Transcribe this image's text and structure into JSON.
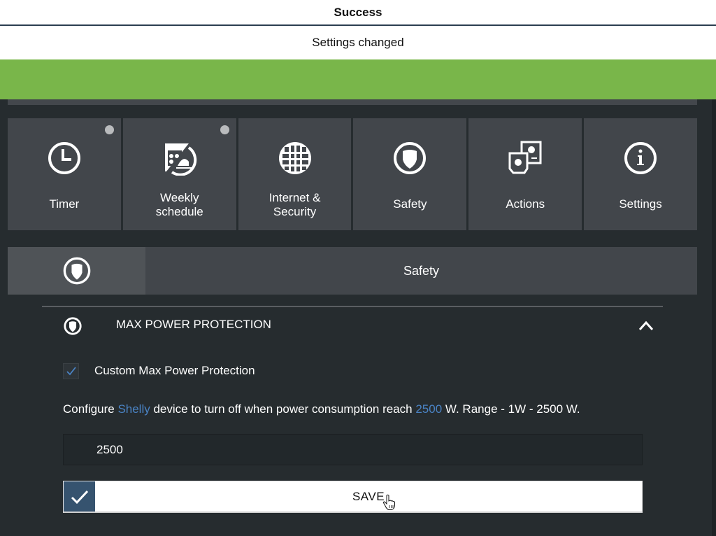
{
  "toast": {
    "title": "Success",
    "message": "Settings changed",
    "accent_color": "#79b64a"
  },
  "tiles": [
    {
      "label": "Timer",
      "icon": "clock-icon",
      "has_indicator": true
    },
    {
      "label": "Weekly\nschedule",
      "icon": "schedule-icon",
      "has_indicator": true
    },
    {
      "label": "Internet &\nSecurity",
      "icon": "globe-icon",
      "has_indicator": false
    },
    {
      "label": "Safety",
      "icon": "shield-icon",
      "has_indicator": false
    },
    {
      "label": "Actions",
      "icon": "actions-icon",
      "has_indicator": false
    },
    {
      "label": "Settings",
      "icon": "info-icon",
      "has_indicator": false
    }
  ],
  "section": {
    "title": "Safety",
    "icon": "shield-icon"
  },
  "accordion": {
    "title": "MAX POWER PROTECTION",
    "expanded": true
  },
  "custom_protection": {
    "label": "Custom Max Power Protection",
    "checked": true
  },
  "description": {
    "prefix": "Configure ",
    "device": "Shelly",
    "middle": " device to turn off when power consumption reach ",
    "value": "2500",
    "suffix": " W. Range - 1W - 2500 W."
  },
  "power_input": {
    "value": "2500"
  },
  "save": {
    "label": "SAVE"
  },
  "colors": {
    "highlight": "#4a83c4",
    "save_check_bg": "#36536f",
    "tile_bg": "#42464b",
    "page_bg": "#262c2f"
  }
}
